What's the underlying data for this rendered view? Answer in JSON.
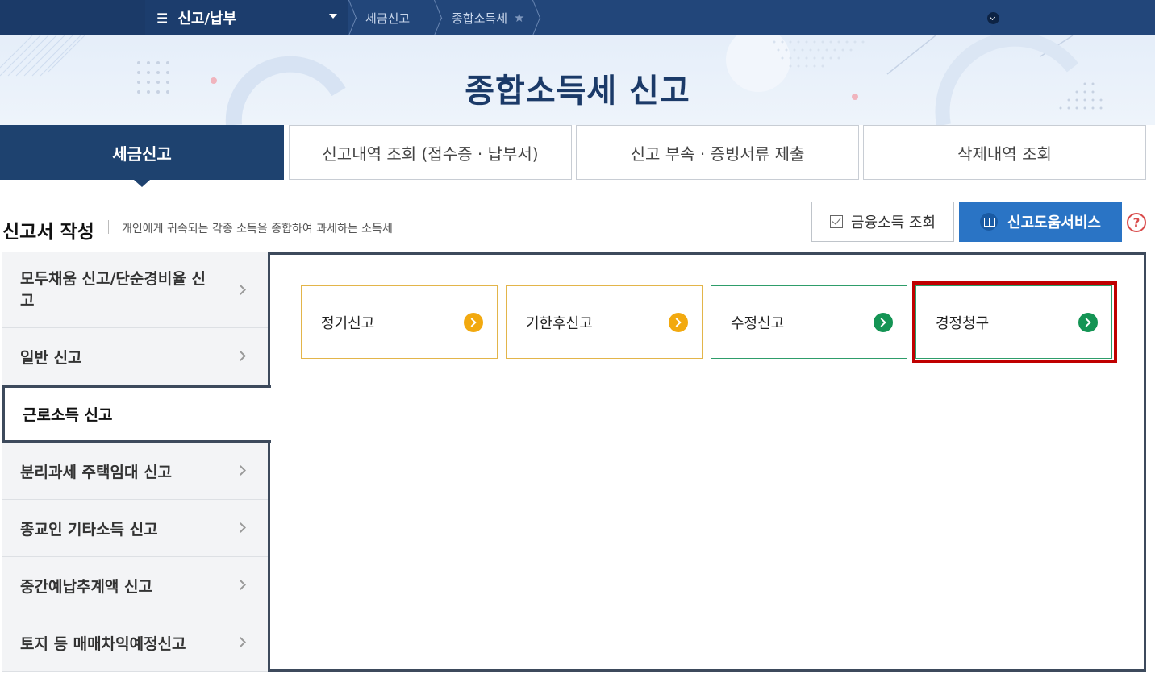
{
  "topnav": {
    "menu_label": "신고/납부",
    "menu_icon": "hamburger-icon",
    "breadcrumbs": [
      "세금신고",
      "종합소득세"
    ],
    "colors": {
      "bar": "#22467a",
      "menu": "#1c3d6d"
    }
  },
  "banner": {
    "title": "종합소득세 신고"
  },
  "tabs": [
    {
      "label": "세금신고",
      "active": true
    },
    {
      "label": "신고내역 조회 (접수증 · 납부서)",
      "active": false
    },
    {
      "label": "신고 부속 · 증빙서류 제출",
      "active": false
    },
    {
      "label": "삭제내역 조회",
      "active": false
    }
  ],
  "section": {
    "title": "신고서 작성",
    "description": "개인에게 귀속되는 각종 소득을 종합하여 과세하는 소득세",
    "financial_button": "금융소득 조회",
    "help_button": "신고도움서비스",
    "help_question": "?"
  },
  "sidebar": {
    "items": [
      {
        "label": "모두채움 신고/단순경비율 신고",
        "active": false
      },
      {
        "label": "일반 신고",
        "active": false
      },
      {
        "label": "근로소득 신고",
        "active": true
      },
      {
        "label": "분리과세 주택임대 신고",
        "active": false
      },
      {
        "label": "종교인 기타소득 신고",
        "active": false
      },
      {
        "label": "중간예납추계액 신고",
        "active": false
      },
      {
        "label": "토지 등 매매차익예정신고",
        "active": false
      }
    ]
  },
  "cards": [
    {
      "label": "정기신고",
      "color": "#f2a90f"
    },
    {
      "label": "기한후신고",
      "color": "#f2a90f"
    },
    {
      "label": "수정신고",
      "color": "#149454"
    },
    {
      "label": "경정청구",
      "color": "#149454",
      "highlighted": true
    }
  ],
  "colors": {
    "primary": "#1e426f",
    "help_button": "#2a74c5",
    "highlight": "#c00000"
  }
}
